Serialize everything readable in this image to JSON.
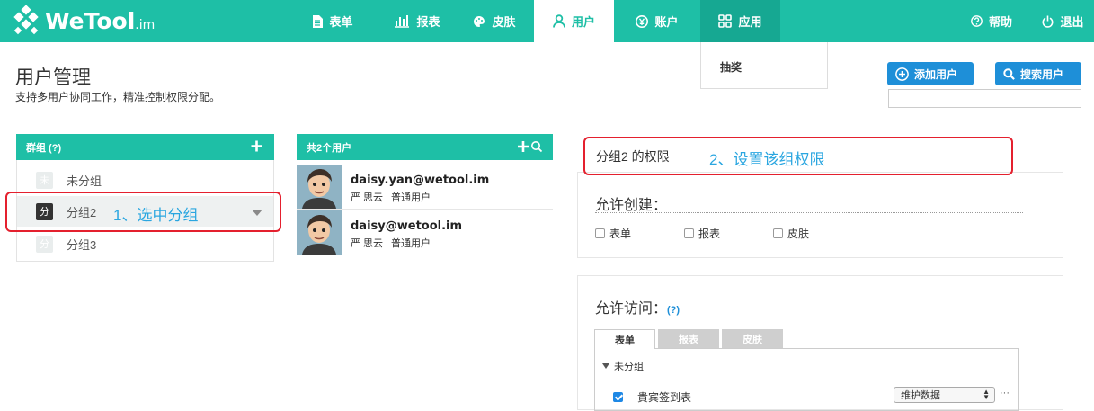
{
  "brand": {
    "name": "WeTool",
    "suffix": ".im"
  },
  "nav": [
    {
      "label": "表单",
      "icon": "form-icon"
    },
    {
      "label": "报表",
      "icon": "chart-icon"
    },
    {
      "label": "皮肤",
      "icon": "palette-icon"
    },
    {
      "label": "用户",
      "icon": "user-icon"
    },
    {
      "label": "账户",
      "icon": "account-icon"
    },
    {
      "label": "应用",
      "icon": "apps-icon"
    }
  ],
  "header_right": {
    "help": "帮助",
    "logout": "退出"
  },
  "apps_menu": {
    "item": "抽奖"
  },
  "page": {
    "title": "用户管理",
    "subtitle": "支持多用户协同工作，精准控制权限分配。"
  },
  "actions": {
    "add_user": "添加用户",
    "search_user": "搜索用户",
    "search_value": ""
  },
  "groups": {
    "header": "群组 (?)",
    "items": [
      {
        "badge": "未",
        "label": "未分组"
      },
      {
        "badge": "分",
        "label": "分组2"
      },
      {
        "badge": "分",
        "label": "分组3"
      }
    ]
  },
  "users": {
    "header": "共2个用户",
    "items": [
      {
        "email": "daisy.yan@wetool.im",
        "meta": "严 思云 | 普通用户"
      },
      {
        "email": "daisy@wetool.im",
        "meta": "严 思云 | 普通用户"
      }
    ]
  },
  "annotations": {
    "step1": "1、选中分组",
    "step2": "2、设置该组权限"
  },
  "permissions": {
    "title": "分组2 的权限",
    "create": {
      "title": "允许创建：",
      "options": [
        "表单",
        "报表",
        "皮肤"
      ]
    },
    "access": {
      "title": "允许访问：",
      "help": "(?)",
      "tabs": [
        "表单",
        "报表",
        "皮肤"
      ],
      "group_label": "未分组",
      "row": {
        "label": "貴宾签到表",
        "checked": true,
        "select": "维护数据",
        "more": "···"
      }
    }
  },
  "colors": {
    "accent": "#1ebfa6",
    "button_blue": "#1e8fd8",
    "annotation": "#2aa6e0",
    "highlight_box": "#e4202e"
  }
}
